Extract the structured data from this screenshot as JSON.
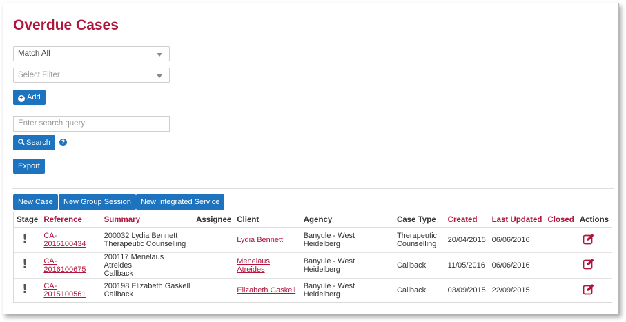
{
  "page_title": "Overdue Cases",
  "filters": {
    "match_select": "Match All",
    "filter_select_placeholder": "Select Filter",
    "add_label": "Add"
  },
  "search": {
    "placeholder": "Enter search query",
    "button_label": "Search",
    "help_glyph": "?"
  },
  "export_label": "Export",
  "actions": {
    "new_case": "New Case",
    "new_group_session": "New Group Session",
    "new_integrated_service": "New Integrated Service"
  },
  "table": {
    "headers": [
      "Stage",
      "Reference",
      "Summary",
      "Assignee",
      "Client",
      "Agency",
      "Case Type",
      "Created",
      "Last Updated",
      "Closed",
      "Actions"
    ],
    "rows": [
      {
        "stage": "!",
        "reference": "CA-2015100434",
        "summary_line1": "200032 Lydia Bennett",
        "summary_line2": "Therapeutic Counselling",
        "assignee": "",
        "client": "Lydia Bennett",
        "agency": "Banyule - West Heidelberg",
        "case_type_line1": "Therapeutic",
        "case_type_line2": "Counselling",
        "created": "20/04/2015",
        "last_updated": "06/06/2016",
        "closed": ""
      },
      {
        "stage": "!",
        "reference": "CA-2016100675",
        "summary_line1": "200117 Menelaus Atreides",
        "summary_line2": "Callback",
        "assignee": "",
        "client": "Menelaus Atreides",
        "agency": "Banyule - West Heidelberg",
        "case_type_line1": "Callback",
        "case_type_line2": "",
        "created": "11/05/2016",
        "last_updated": "06/06/2016",
        "closed": ""
      },
      {
        "stage": "!",
        "reference": "CA-2015100561",
        "summary_line1": "200198 Elizabeth Gaskell",
        "summary_line2": "Callback",
        "assignee": "",
        "client": "Elizabeth Gaskell",
        "agency": "Banyule - West Heidelberg",
        "case_type_line1": "Callback",
        "case_type_line2": "",
        "created": "03/09/2015",
        "last_updated": "22/09/2015",
        "closed": ""
      }
    ]
  },
  "colors": {
    "accent": "#b0153c",
    "button": "#1e73be"
  }
}
